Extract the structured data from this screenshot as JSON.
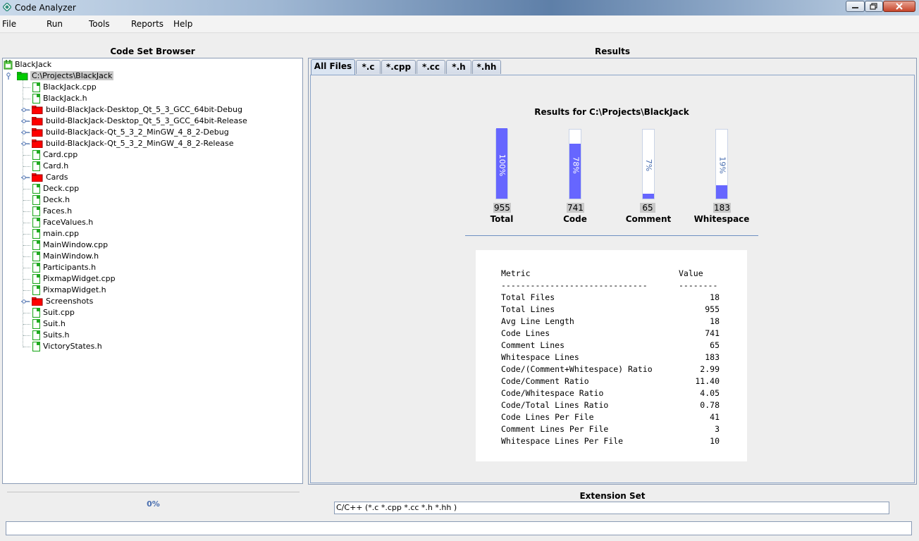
{
  "window": {
    "title": "Code Analyzer"
  },
  "menu": [
    "File",
    "Run",
    "Tools",
    "Reports",
    "Help"
  ],
  "browser": {
    "heading": "Code Set Browser",
    "root": "BlackJack",
    "project": "C:\\Projects\\BlackJack",
    "items": [
      {
        "label": "BlackJack.cpp",
        "type": "file"
      },
      {
        "label": "BlackJack.h",
        "type": "file"
      },
      {
        "label": "build-BlackJack-Desktop_Qt_5_3_GCC_64bit-Debug",
        "type": "folder"
      },
      {
        "label": "build-BlackJack-Desktop_Qt_5_3_GCC_64bit-Release",
        "type": "folder"
      },
      {
        "label": "build-BlackJack-Qt_5_3_2_MinGW_4_8_2-Debug",
        "type": "folder"
      },
      {
        "label": "build-BlackJack-Qt_5_3_2_MinGW_4_8_2-Release",
        "type": "folder"
      },
      {
        "label": "Card.cpp",
        "type": "file"
      },
      {
        "label": "Card.h",
        "type": "file"
      },
      {
        "label": "Cards",
        "type": "folder"
      },
      {
        "label": "Deck.cpp",
        "type": "file"
      },
      {
        "label": "Deck.h",
        "type": "file"
      },
      {
        "label": "Faces.h",
        "type": "file"
      },
      {
        "label": "FaceValues.h",
        "type": "file"
      },
      {
        "label": "main.cpp",
        "type": "file"
      },
      {
        "label": "MainWindow.cpp",
        "type": "file"
      },
      {
        "label": "MainWindow.h",
        "type": "file"
      },
      {
        "label": "Participants.h",
        "type": "file"
      },
      {
        "label": "PixmapWidget.cpp",
        "type": "file"
      },
      {
        "label": "PixmapWidget.h",
        "type": "file"
      },
      {
        "label": "Screenshots",
        "type": "folder"
      },
      {
        "label": "Suit.cpp",
        "type": "file"
      },
      {
        "label": "Suit.h",
        "type": "file"
      },
      {
        "label": "Suits.h",
        "type": "file"
      },
      {
        "label": "VictoryStates.h",
        "type": "file"
      }
    ]
  },
  "results": {
    "heading": "Results",
    "tabs": [
      "All Files",
      "*.c",
      "*.cpp",
      "*.cc",
      "*.h",
      "*.hh"
    ],
    "active_tab": 0,
    "title": "Results for C:\\Projects\\BlackJack",
    "bars": [
      {
        "name": "Total",
        "count": "955",
        "pct_label": "100%",
        "fraction": 1.0
      },
      {
        "name": "Code",
        "count": "741",
        "pct_label": "78%",
        "fraction": 0.78
      },
      {
        "name": "Comment",
        "count": "65",
        "pct_label": "7%",
        "fraction": 0.07
      },
      {
        "name": "Whitespace",
        "count": "183",
        "pct_label": "19%",
        "fraction": 0.19
      }
    ],
    "table": {
      "metric_header": "Metric",
      "value_header": "Value",
      "metric_rule": "------------------------------",
      "value_rule": "--------",
      "rows": [
        {
          "metric": "Total Files",
          "value": "18"
        },
        {
          "metric": "Total Lines",
          "value": "955"
        },
        {
          "metric": "Avg Line Length",
          "value": "18"
        },
        {
          "metric": "Code Lines",
          "value": "741"
        },
        {
          "metric": "Comment Lines",
          "value": "65"
        },
        {
          "metric": "Whitespace Lines",
          "value": "183"
        },
        {
          "metric": "Code/(Comment+Whitespace) Ratio",
          "value": "2.99"
        },
        {
          "metric": "Code/Comment Ratio",
          "value": "11.40"
        },
        {
          "metric": "Code/Whitespace Ratio",
          "value": "4.05"
        },
        {
          "metric": "Code/Total Lines Ratio",
          "value": "0.78"
        },
        {
          "metric": "Code Lines Per File",
          "value": "41"
        },
        {
          "metric": "Comment Lines Per File",
          "value": "3"
        },
        {
          "metric": "Whitespace Lines Per File",
          "value": "10"
        }
      ]
    }
  },
  "progress": {
    "value": 0,
    "label": "0%"
  },
  "extension_set": {
    "heading": "Extension Set",
    "value": "C/C++  (*.c *.cpp *.cc *.h *.hh )"
  },
  "colors": {
    "bar": "#6666ff",
    "folder": "#ff0000",
    "file_icon": "#22aa22",
    "percent_text": "#4a6fb0"
  }
}
